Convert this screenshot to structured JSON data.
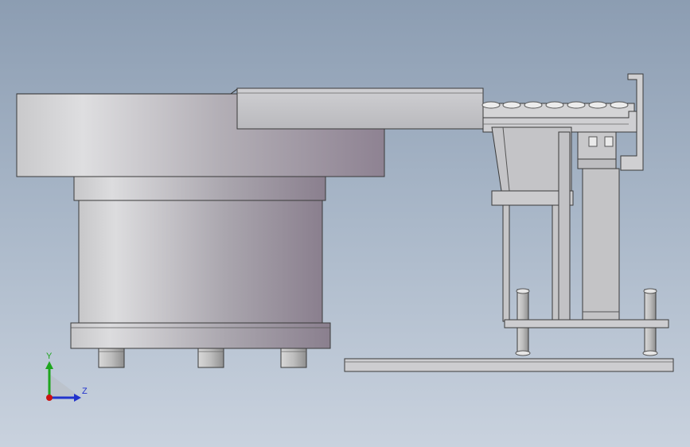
{
  "viewport": {
    "background_top": "#8c9db2",
    "background_bottom": "#c9d2de"
  },
  "model": {
    "type": "3D CAD assembly",
    "view": "side view",
    "parts": [
      "vibratory-bowl",
      "bowl-base",
      "feet",
      "linear-track",
      "rollers",
      "track-bracket",
      "support-frame",
      "base-plate",
      "end-stop"
    ]
  },
  "triad": {
    "y_label": "Y",
    "z_label": "Z",
    "y_color": "#1ea51e",
    "z_color": "#2233cc",
    "x_color": "#cc1111"
  }
}
